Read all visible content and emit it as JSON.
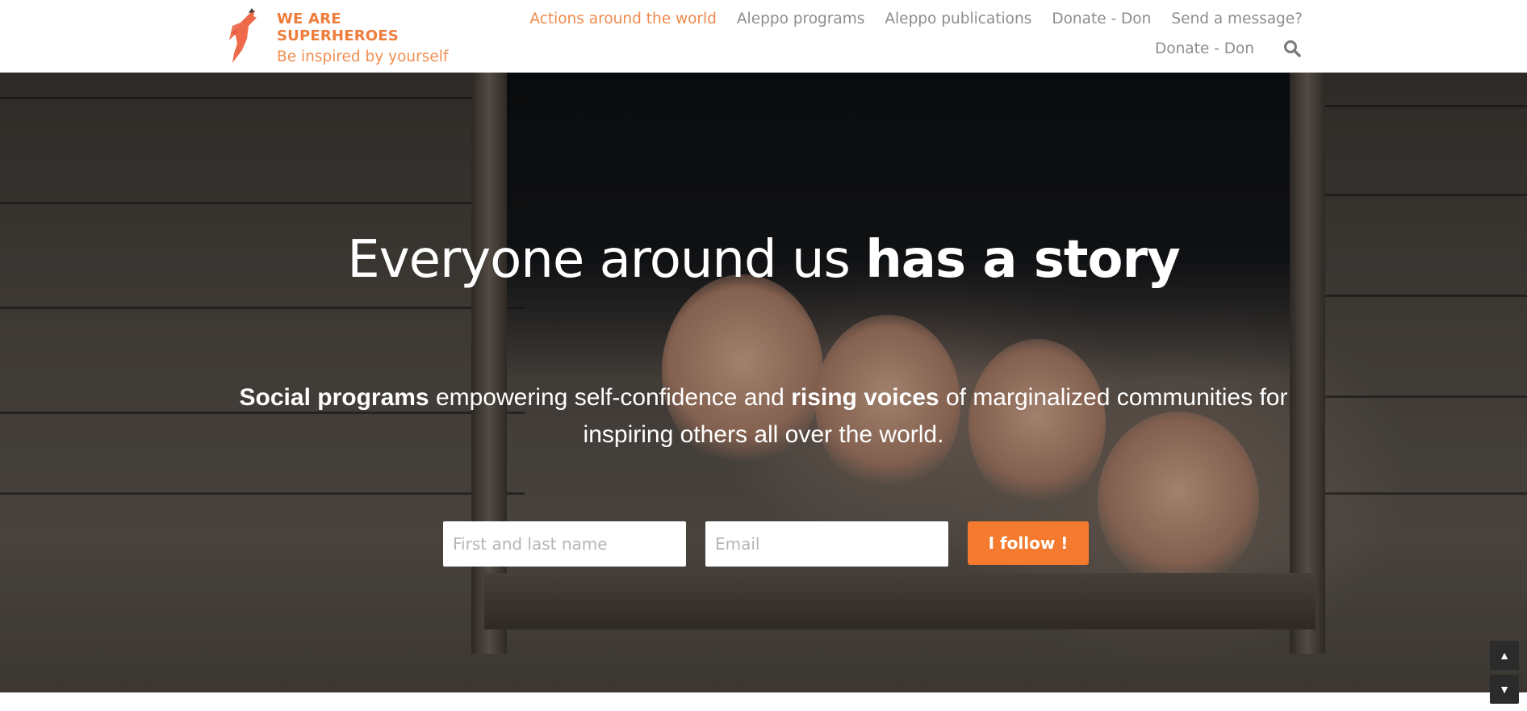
{
  "brand": {
    "line1": "WE ARE",
    "line2": "SUPERHEROES",
    "tagline": "Be inspired by yourself",
    "accent_color": "#ee7c3b",
    "logo_icon": "flying-superhero-icon"
  },
  "nav": {
    "row1": [
      {
        "label": "Actions around the world",
        "active": true
      },
      {
        "label": "Aleppo programs",
        "active": false
      },
      {
        "label": "Aleppo publications",
        "active": false
      },
      {
        "label": "Donate - Don",
        "active": false
      },
      {
        "label": "Send a message?",
        "active": false
      }
    ],
    "row2": [
      {
        "label": "Donate - Don",
        "active": false
      }
    ],
    "search_icon": "search-icon",
    "text_color": "#8d8d8d",
    "active_color": "#ee8a4d"
  },
  "hero": {
    "title_light": "Everyone around us ",
    "title_bold": "has a story",
    "sub_bold1": "Social programs",
    "sub_text1": " empowering self-confidence and ",
    "sub_bold2": "rising voices",
    "sub_text2": " of marginalized communities for inspiring others all over the world."
  },
  "form": {
    "name_placeholder": "First and last name",
    "email_placeholder": "Email",
    "name_value": "",
    "email_value": "",
    "submit_label": "I follow !",
    "button_color": "#f37a2e"
  },
  "scroll": {
    "up_icon": "triangle-up-icon",
    "down_icon": "triangle-down-icon",
    "up_glyph": "▲",
    "down_glyph": "▼"
  }
}
